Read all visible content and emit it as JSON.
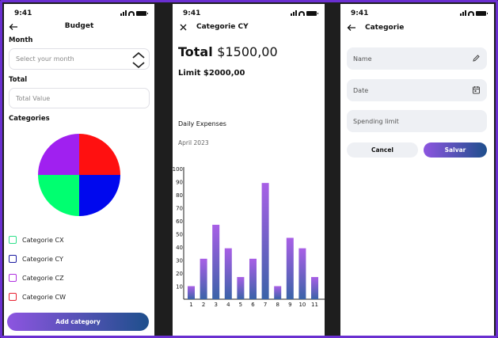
{
  "status_time": "9:41",
  "budget": {
    "title": "Budget",
    "month_label": "Month",
    "month_placeholder": "Select your month",
    "total_label": "Total",
    "total_placeholder": "Total Value",
    "categories_label": "Categories",
    "pie_colors": [
      "#a020f0",
      "#ff1010",
      "#00ff70",
      "#0008ee"
    ],
    "categories": [
      {
        "label": "Categorie CX",
        "color": "#2ee08a"
      },
      {
        "label": "Categorie CY",
        "color": "#1a1aa0"
      },
      {
        "label": "Categorie CZ",
        "color": "#b030e0"
      },
      {
        "label": "Categorie CW",
        "color": "#e82030"
      }
    ],
    "add_button": "Add category"
  },
  "detail": {
    "title": "Categorie CY",
    "total_prefix": "Total",
    "total_value": "$1500,00",
    "limit_text": "Limit $2000,00",
    "daily_label": "Daily Expenses",
    "period": "April 2023"
  },
  "chart_data": {
    "type": "bar",
    "categories": [
      "1",
      "2",
      "3",
      "4",
      "5",
      "6",
      "7",
      "8",
      "9",
      "10",
      "11"
    ],
    "values": [
      10,
      31,
      57,
      39,
      17,
      31,
      89,
      10,
      47,
      39,
      17
    ],
    "yticks": [
      10,
      20,
      30,
      40,
      50,
      60,
      70,
      80,
      90,
      100
    ],
    "ylim": [
      0,
      100
    ],
    "bar_gradient": [
      "#a85fe6",
      "#3a63a8"
    ]
  },
  "form": {
    "title": "Categorie",
    "name_placeholder": "Name",
    "date_placeholder": "Date",
    "limit_placeholder": "Spending limit",
    "cancel_label": "Cancel",
    "save_label": "Salvar"
  }
}
